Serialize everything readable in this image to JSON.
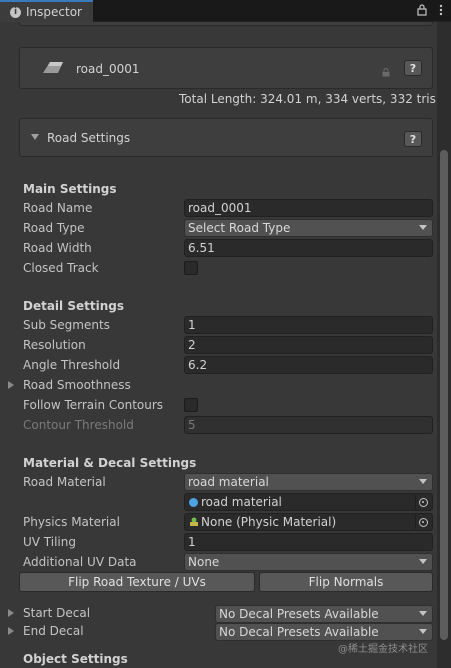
{
  "tab": {
    "title": "Inspector"
  },
  "object_header": {
    "name": "road_0001",
    "help": "?"
  },
  "summary": "Total Length: 324.01 m, 334 verts, 332 tris",
  "road_settings": {
    "title": "Road Settings",
    "help": "?"
  },
  "main_settings": {
    "header": "Main Settings",
    "road_name_label": "Road Name",
    "road_name_value": "road_0001",
    "road_type_label": "Road Type",
    "road_type_value": "Select Road Type",
    "road_width_label": "Road Width",
    "road_width_value": "6.51",
    "closed_track_label": "Closed Track",
    "closed_track_checked": false
  },
  "detail_settings": {
    "header": "Detail Settings",
    "sub_segments_label": "Sub Segments",
    "sub_segments_value": "1",
    "resolution_label": "Resolution",
    "resolution_value": "2",
    "angle_threshold_label": "Angle Threshold",
    "angle_threshold_value": "6.2",
    "road_smoothness_label": "Road Smoothness",
    "follow_terrain_label": "Follow Terrain Contours",
    "follow_terrain_checked": false,
    "contour_threshold_label": "Contour Threshold",
    "contour_threshold_value": "5"
  },
  "material_settings": {
    "header": "Material & Decal Settings",
    "road_material_label": "Road Material",
    "road_material_dropdown": "road material",
    "road_material_object": "road material",
    "physics_material_label": "Physics Material",
    "physics_material_value": "None (Physic Material)",
    "uv_tiling_label": "UV Tiling",
    "uv_tiling_value": "1",
    "additional_uv_label": "Additional UV Data",
    "additional_uv_value": "None",
    "flip_road_button": "Flip Road Texture / UVs",
    "flip_normals_button": "Flip Normals",
    "start_decal_label": "Start Decal",
    "start_decal_value": "No Decal Presets Available",
    "end_decal_label": "End Decal",
    "end_decal_value": "No Decal Presets Available"
  },
  "object_settings": {
    "header": "Object Settings"
  },
  "watermark": "@稀土掘金技术社区",
  "colors": {
    "tab_accent": "#3a79bb",
    "mesh_icon": "#9a9a9a",
    "material_icon": "#4fa3e0",
    "physic_icon": "#6fbf4a"
  }
}
